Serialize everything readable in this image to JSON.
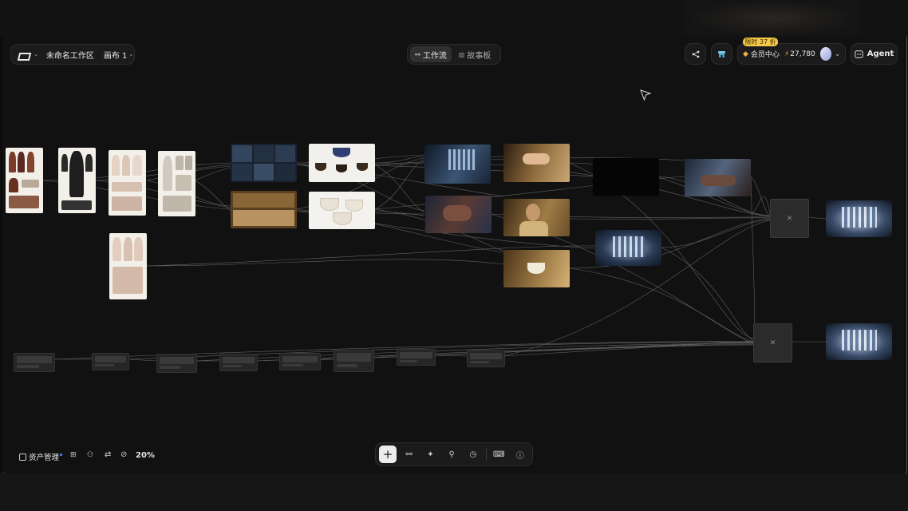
{
  "header": {
    "workspace": "未命名工作区",
    "canvas": "画布 1",
    "tabs": [
      {
        "label": "工作流",
        "active": true
      },
      {
        "label": "故事板",
        "active": false
      }
    ],
    "promo_badge": "限时 37 折",
    "member_center": "会员中心",
    "credits": "27,780",
    "agent_label": "Agent"
  },
  "footer": {
    "assets_label": "资产管理",
    "zoom": "20%"
  },
  "colors": {
    "accent": "#f0a23a",
    "badge_bg": "#f5c94a",
    "canvas_bg": "#111111"
  }
}
